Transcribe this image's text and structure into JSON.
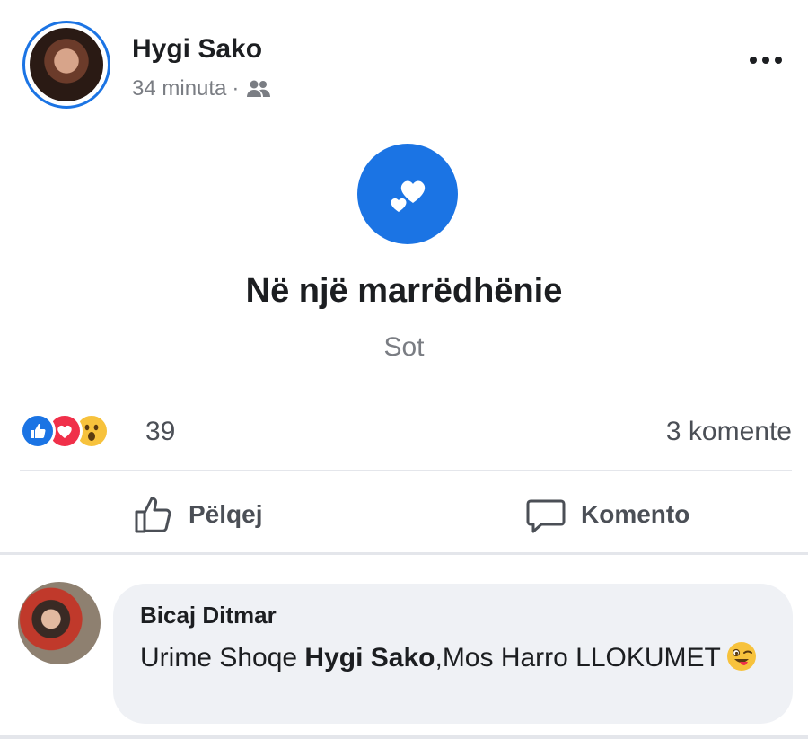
{
  "post": {
    "author": "Hygi Sako",
    "time": "34 minuta",
    "separator": "·",
    "audience_icon": "friends-icon",
    "more_icon": "more-horizontal-icon"
  },
  "life_event": {
    "icon": "hearts-icon",
    "title": "Në një marrëdhënie",
    "date": "Sot"
  },
  "reactions": {
    "icons": [
      "like-reaction-icon",
      "love-reaction-icon",
      "wow-reaction-icon"
    ],
    "count": "39",
    "comments": "3 komente"
  },
  "actions": {
    "like_label": "Pëlqej",
    "comment_label": "Komento"
  },
  "comment": {
    "author": "Bicaj Ditmar",
    "text_before": "Urime Shoqe ",
    "mention": "Hygi Sako",
    "text_after": ",Mos Harro LLOKUMET",
    "emoji": "winking-tongue-emoji"
  },
  "colors": {
    "accent": "#1b74e4",
    "love": "#f0304a",
    "wow": "#f7c23c",
    "muted_text": "#7a7d83",
    "bubble": "#eff1f5"
  }
}
